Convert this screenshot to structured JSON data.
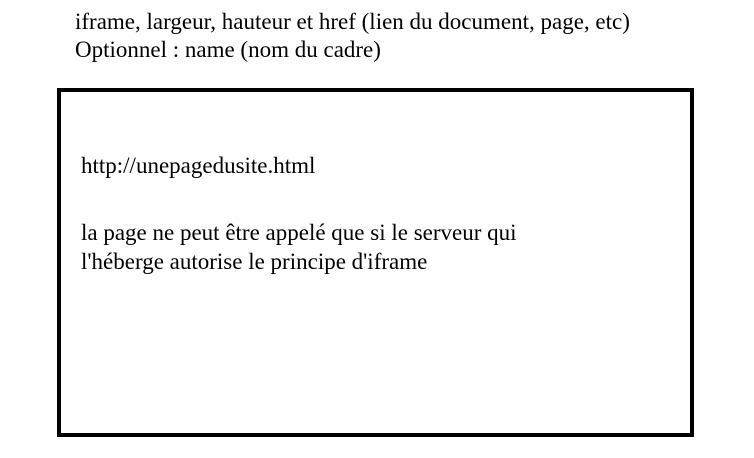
{
  "header": {
    "line1": "iframe, largeur, hauteur et href (lien du document, page, etc)",
    "line2": "Optionnel : name (nom du cadre)"
  },
  "iframe": {
    "url": "http://unepagedusite.html",
    "note_line1": "la page ne peut être appelé que si le serveur qui",
    "note_line2": "l'héberge autorise le principe d'iframe"
  },
  "colors": {
    "border": "#000000",
    "background": "#ffffff",
    "text": "#000000"
  }
}
